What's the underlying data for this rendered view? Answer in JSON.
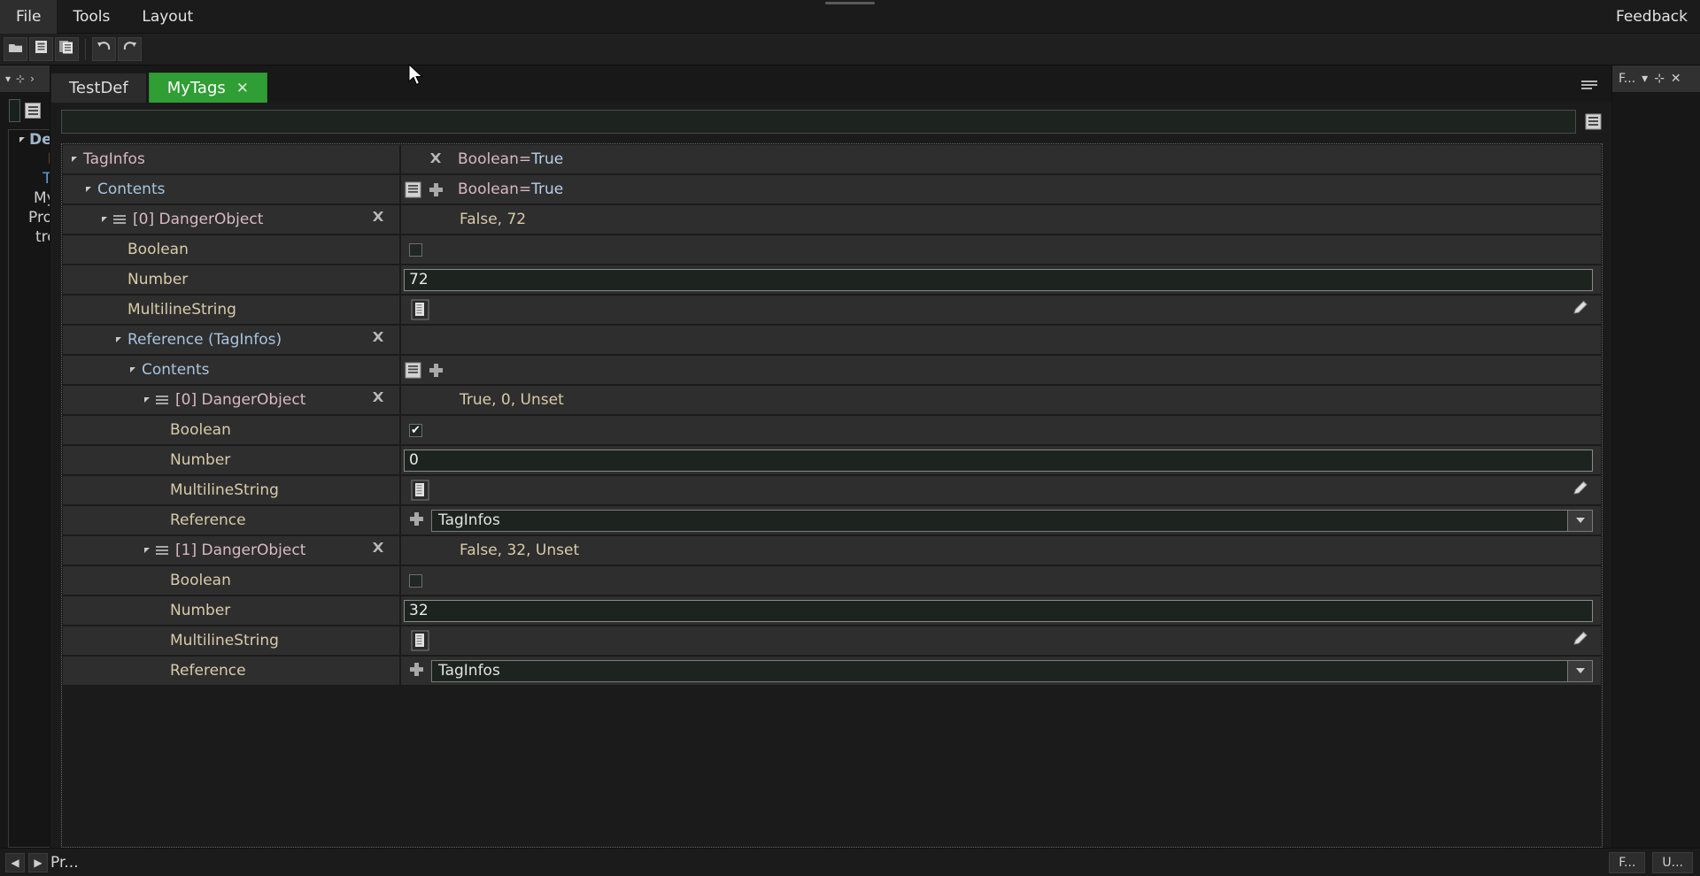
{
  "menubar": {
    "items": [
      {
        "label": "File",
        "name": "menu-file"
      },
      {
        "label": "Tools",
        "name": "menu-tools"
      },
      {
        "label": "Layout",
        "name": "menu-layout"
      }
    ],
    "feedback": "Feedback"
  },
  "toolbar": {
    "buttons": [
      {
        "name": "open-button",
        "icon": "folder-icon"
      },
      {
        "name": "save-button",
        "icon": "save-icon"
      },
      {
        "name": "save-as-button",
        "icon": "save-as-icon"
      },
      {
        "name": "undo-button",
        "icon": "undo-icon"
      },
      {
        "name": "redo-button",
        "icon": "redo-icon"
      }
    ]
  },
  "tabs": [
    {
      "label": "TestDef",
      "active": false,
      "closable": false
    },
    {
      "label": "MyTags",
      "active": true,
      "closable": true,
      "close_glyph": "✕",
      "accent": "#2f9e34"
    }
  ],
  "search": {
    "value": "",
    "placeholder": "",
    "icon": "list-options-icon"
  },
  "left_panel": {
    "header_icons": [
      "chevron-down-icon",
      "pin-icon",
      "chevron-right-icon"
    ],
    "tree": [
      {
        "label": "De",
        "level": 0
      },
      {
        "label": "D",
        "level": 1
      },
      {
        "label": "T",
        "level": 2
      },
      {
        "label": "My",
        "level": 3
      },
      {
        "label": "Pro",
        "level": 4
      },
      {
        "label": "tre",
        "level": 5
      }
    ]
  },
  "right_panel": {
    "title": "F...",
    "icons": [
      "chevron-down-icon",
      "pin-icon",
      "close-icon"
    ]
  },
  "statusbar": {
    "left_arrows": [
      "◀",
      "▶"
    ],
    "project_label": "Pr...",
    "tags": [
      "F...",
      "U..."
    ]
  },
  "grid": {
    "rows": [
      {
        "name": "TagInfos",
        "indent": 0,
        "label_class": "lbl-pink",
        "expander": true,
        "grip": false,
        "delete": false,
        "value_type": "summary",
        "value_icons": [
          "delete-x-icon"
        ],
        "value_text": "Boolean=",
        "value_bold": "True"
      },
      {
        "name": "Contents",
        "indent": 1,
        "label_class": "lbl-blue",
        "expander": true,
        "grip": false,
        "delete": false,
        "value_type": "summary",
        "value_icons": [
          "list-icon",
          "add-plus-icon"
        ],
        "value_text": "Boolean=",
        "value_bold": "True"
      },
      {
        "name": "[0] DangerObject",
        "indent": 2,
        "label_class": "lbl-obj",
        "expander": true,
        "grip": true,
        "delete": true,
        "value_type": "summary_plain",
        "value_text": "False, 72"
      },
      {
        "name": "Boolean",
        "indent": 3,
        "label_class": "lbl-tan",
        "expander": false,
        "grip": false,
        "delete": false,
        "value_type": "checkbox",
        "checked": false
      },
      {
        "name": "Number",
        "indent": 3,
        "label_class": "lbl-tan",
        "expander": false,
        "grip": false,
        "delete": false,
        "value_type": "number",
        "value_text": "72"
      },
      {
        "name": "MultilineString",
        "indent": 3,
        "label_class": "lbl-tan",
        "expander": false,
        "grip": false,
        "delete": false,
        "value_type": "multiline",
        "value_icons": [
          "document-icon",
          "pencil-edit-icon"
        ]
      },
      {
        "name": "Reference (TagInfos)",
        "indent": 3,
        "label_class": "lbl-blue",
        "expander": true,
        "grip": false,
        "delete": true,
        "value_type": "empty"
      },
      {
        "name": "Contents",
        "indent": 4,
        "label_class": "lbl-blue",
        "expander": true,
        "grip": false,
        "delete": false,
        "value_type": "icons_only",
        "value_icons": [
          "list-icon",
          "add-plus-icon"
        ]
      },
      {
        "name": "[0] DangerObject",
        "indent": 5,
        "label_class": "lbl-obj",
        "expander": true,
        "grip": true,
        "delete": true,
        "value_type": "summary_plain",
        "value_text": "True, 0, Unset"
      },
      {
        "name": "Boolean",
        "indent": 6,
        "label_class": "lbl-tan",
        "expander": false,
        "grip": false,
        "delete": false,
        "value_type": "checkbox",
        "checked": true
      },
      {
        "name": "Number",
        "indent": 6,
        "label_class": "lbl-tan",
        "expander": false,
        "grip": false,
        "delete": false,
        "value_type": "number",
        "value_text": "0"
      },
      {
        "name": "MultilineString",
        "indent": 6,
        "label_class": "lbl-tan",
        "expander": false,
        "grip": false,
        "delete": false,
        "value_type": "multiline",
        "value_icons": [
          "document-icon",
          "pencil-edit-icon"
        ]
      },
      {
        "name": "Reference",
        "indent": 6,
        "label_class": "lbl-tan",
        "expander": false,
        "grip": false,
        "delete": false,
        "value_type": "combo",
        "value_text": "TagInfos",
        "value_icons": [
          "add-plus-icon",
          "chevron-down-icon"
        ]
      },
      {
        "name": "[1] DangerObject",
        "indent": 5,
        "label_class": "lbl-obj",
        "expander": true,
        "grip": true,
        "delete": true,
        "value_type": "summary_plain",
        "value_text": "False, 32, Unset"
      },
      {
        "name": "Boolean",
        "indent": 6,
        "label_class": "lbl-tan",
        "expander": false,
        "grip": false,
        "delete": false,
        "value_type": "checkbox",
        "checked": false
      },
      {
        "name": "Number",
        "indent": 6,
        "label_class": "lbl-tan",
        "expander": false,
        "grip": false,
        "delete": false,
        "value_type": "number",
        "value_text": "32"
      },
      {
        "name": "MultilineString",
        "indent": 6,
        "label_class": "lbl-tan",
        "expander": false,
        "grip": false,
        "delete": false,
        "value_type": "multiline",
        "value_icons": [
          "document-icon",
          "pencil-edit-icon"
        ]
      },
      {
        "name": "Reference",
        "indent": 6,
        "label_class": "lbl-tan",
        "expander": false,
        "grip": false,
        "delete": false,
        "value_type": "combo",
        "value_text": "TagInfos",
        "value_icons": [
          "add-plus-icon",
          "chevron-down-icon"
        ]
      }
    ]
  }
}
